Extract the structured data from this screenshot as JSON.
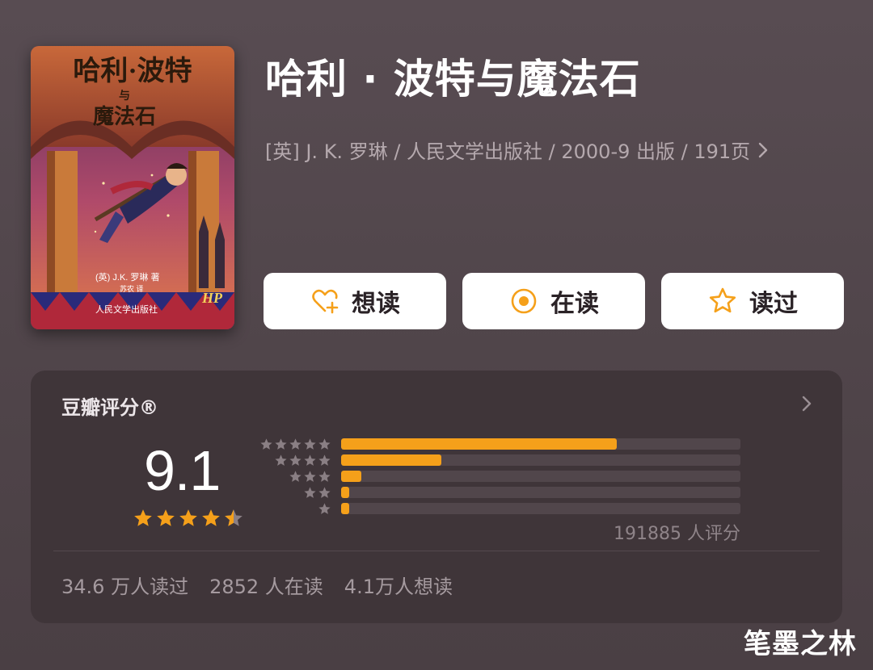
{
  "book": {
    "title": "哈利 · 波特与魔法石",
    "meta": "[英] J. K. 罗琳 / 人民文学出版社 / 2000-9 出版 / 191页",
    "cover": {
      "title_line1": "哈利·波特",
      "title_line2": "与",
      "title_line3": "魔法石",
      "author": "(英) J.K. 罗琳 著",
      "translator": "苏农 译",
      "publisher": "人民文学出版社",
      "logo": "HP"
    }
  },
  "actions": [
    {
      "label": "想读",
      "icon": "heart-plus-icon"
    },
    {
      "label": "在读",
      "icon": "target-icon"
    },
    {
      "label": "读过",
      "icon": "star-outline-icon"
    }
  ],
  "rating": {
    "title": "豆瓣评分®",
    "score": "9.1",
    "stars": 4.5,
    "distribution": [
      {
        "stars": 5,
        "fraction": 0.69
      },
      {
        "stars": 4,
        "fraction": 0.25
      },
      {
        "stars": 3,
        "fraction": 0.05
      },
      {
        "stars": 2,
        "fraction": 0.02
      },
      {
        "stars": 1,
        "fraction": 0.02
      }
    ],
    "count_text": "191885 人评分",
    "stats": {
      "read": "34.6 万人读过",
      "reading": "2852 人在读",
      "want": "4.1万人想读"
    }
  },
  "watermark": "笔墨之林",
  "colors": {
    "accent": "#f5a01a",
    "background": "#584c52",
    "panel": "#3f3539"
  }
}
